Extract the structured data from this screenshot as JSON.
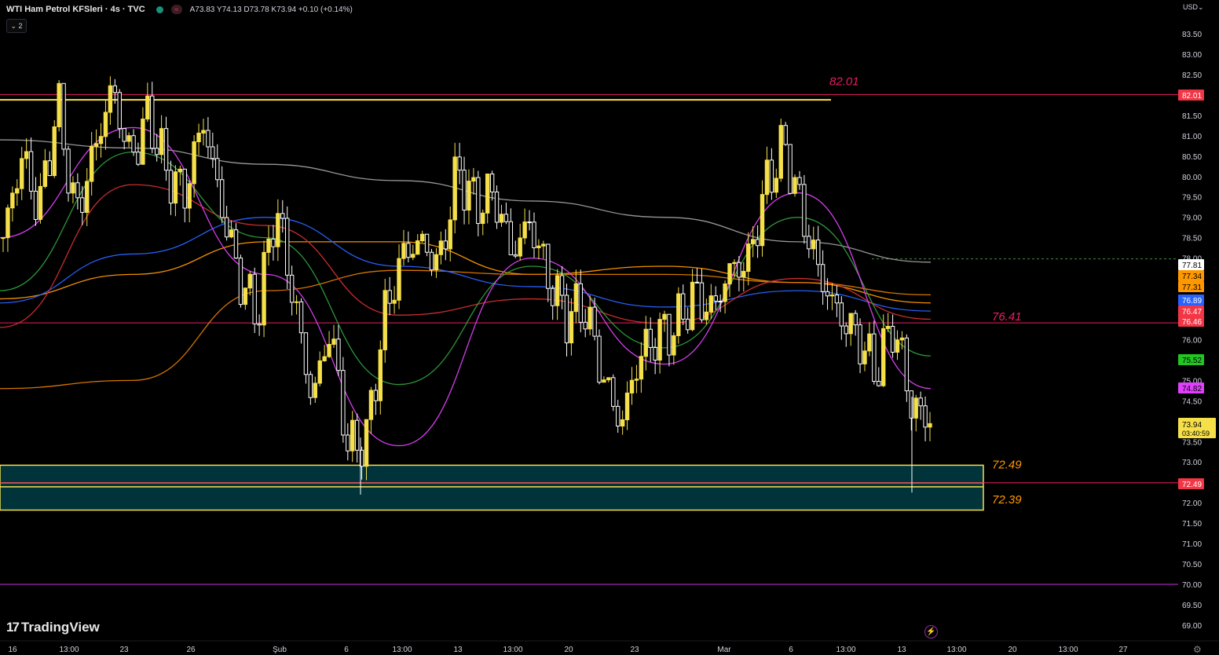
{
  "header": {
    "symbol": "WTI Ham Petrol KFSleri · 4s · TVC",
    "ohlc_text": "A73.83 Y74.13 D73.78 K73.94 +0.10 (+0.14%)",
    "indicators_badge": "⌄ 2",
    "market_status_icon": "market-open-dot",
    "flag_icon": "wave-flag-icon"
  },
  "currency": "USD⌄",
  "branding": {
    "logo_text": "TradingView",
    "logo_mark": "17"
  },
  "icons": {
    "bolt": "lightning-icon",
    "settings": "gear-icon"
  },
  "colors": {
    "background": "#000000",
    "candle_up": "#f5e04a",
    "candle_down": "#ffffff",
    "resistance": "#e91e63",
    "support_box_fill": "#00333a",
    "support_box_border": "#f5e04a",
    "line_70": "#9c27b0",
    "ma_gray": "#9e9e9e",
    "ma_orange": "#ff9800",
    "ma_darkorange": "#e07a00",
    "ma_blue": "#2962ff",
    "ma_red": "#d32f2f",
    "ma_green": "#2e9e3a",
    "ma_magenta": "#e040fb"
  },
  "chart_data": {
    "type": "candlestick",
    "timeframe": "4s",
    "ylim": [
      68.8,
      84.0
    ],
    "y_ticks": [
      "83.50",
      "83.00",
      "82.50",
      "82.00",
      "81.50",
      "81.00",
      "80.50",
      "80.00",
      "79.50",
      "79.00",
      "78.50",
      "78.00",
      "77.50",
      "77.00",
      "76.50",
      "76.00",
      "75.50",
      "75.00",
      "74.50",
      "74.00",
      "73.50",
      "73.00",
      "72.50",
      "72.00",
      "71.50",
      "71.00",
      "70.50",
      "70.00",
      "69.50",
      "69.00"
    ],
    "x_ticks": [
      "16",
      "13:00",
      "23",
      "26",
      "Şub",
      "6",
      "13:00",
      "13",
      "13:00",
      "20",
      "23",
      "Mar",
      "6",
      "13:00",
      "13",
      "13:00",
      "20",
      "13:00",
      "27"
    ],
    "close_path": [
      78.5,
      80.5,
      79.2,
      81.8,
      79.0,
      80.6,
      82.2,
      80.4,
      81.5,
      80.1,
      79.6,
      81.4,
      79.3,
      77.5,
      76.6,
      79.3,
      77.0,
      74.5,
      76.3,
      73.3,
      73.6,
      76.6,
      78.1,
      78.4,
      77.8,
      80.2,
      79.3,
      79.6,
      78.1,
      78.9,
      77.5,
      76.6,
      76.8,
      75.1,
      73.9,
      75.6,
      76.1,
      76.3,
      77.1,
      76.7,
      77.7,
      77.9,
      79.8,
      80.8,
      79.0,
      77.5,
      76.6,
      76.1,
      75.2,
      76.4,
      74.4,
      73.94
    ],
    "last": {
      "value": "73.94",
      "countdown": "03:40:59"
    },
    "levels": [
      {
        "name": "resistance-82",
        "value": 82.01,
        "label": "82.01"
      },
      {
        "name": "level-76",
        "value": 76.41,
        "label": "76.41"
      },
      {
        "name": "support-upper",
        "value": 72.49,
        "label": "72.49"
      },
      {
        "name": "support-lower",
        "value": 72.39,
        "label": "72.39"
      },
      {
        "name": "level-70",
        "value": 70.0
      }
    ],
    "support_zone": [
      71.82,
      72.92
    ],
    "horizontal_segment": 81.88,
    "price_tags": [
      {
        "value": "82.01",
        "bg": "#f23645",
        "fg": "#ffffff"
      },
      {
        "value": "77.81",
        "bg": "#ffffff",
        "fg": "#000000"
      },
      {
        "value": "77.34",
        "bg": "#ff9800",
        "fg": "#000000"
      },
      {
        "value": "77.31",
        "bg": "#ff9800",
        "fg": "#000000"
      },
      {
        "value": "76.89",
        "bg": "#2962ff",
        "fg": "#ffffff"
      },
      {
        "value": "76.47",
        "bg": "#f23645",
        "fg": "#ffffff"
      },
      {
        "value": "76.46",
        "bg": "#f23645",
        "fg": "#ffffff"
      },
      {
        "value": "75.52",
        "bg": "#22c522",
        "fg": "#000000"
      },
      {
        "value": "74.82",
        "bg": "#e040fb",
        "fg": "#000000"
      },
      {
        "value": "72.49",
        "bg": "#f23645",
        "fg": "#ffffff"
      }
    ],
    "moving_averages": [
      {
        "color": "#9e9e9e",
        "values": [
          80.9,
          80.7,
          80.3,
          79.9,
          79.4,
          79.0,
          78.4,
          77.9
        ]
      },
      {
        "color": "#ff9800",
        "values": [
          77.0,
          77.6,
          78.4,
          78.4,
          77.6,
          77.8,
          77.4,
          76.9
        ]
      },
      {
        "color": "#e07a00",
        "values": [
          74.8,
          75.0,
          77.2,
          77.7,
          77.6,
          77.6,
          77.4,
          77.1
        ]
      },
      {
        "color": "#2962ff",
        "values": [
          76.9,
          78.1,
          79.0,
          77.8,
          77.3,
          76.8,
          77.2,
          76.7
        ]
      },
      {
        "color": "#d32f2f",
        "values": [
          76.3,
          79.8,
          78.8,
          76.6,
          77.0,
          76.4,
          77.5,
          76.5
        ]
      },
      {
        "color": "#2e9e3a",
        "values": [
          77.2,
          80.6,
          78.5,
          74.9,
          77.8,
          75.8,
          79.0,
          75.6
        ]
      },
      {
        "color": "#e040fb",
        "values": [
          78.5,
          81.2,
          77.6,
          73.4,
          78.0,
          75.4,
          79.6,
          74.8
        ]
      }
    ]
  }
}
